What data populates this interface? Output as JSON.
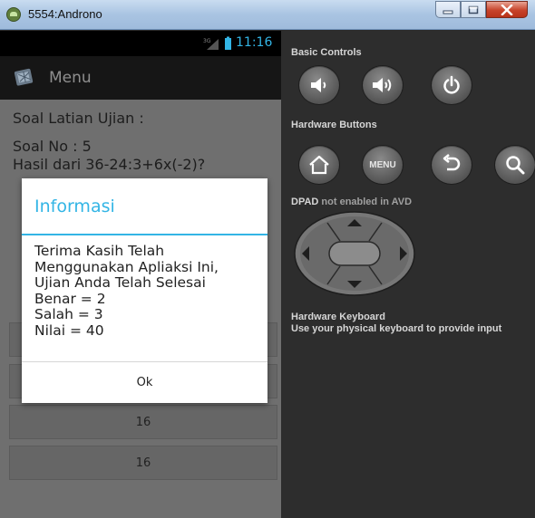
{
  "window": {
    "title": "5554:Androno"
  },
  "phone": {
    "status_time": "11:16",
    "action_bar": {
      "title": "Menu"
    },
    "heading": "Soal Latian Ujian :",
    "question_number": "Soal No : 5",
    "question_text": "Hasil dari 36-24:3+6x(-2)?",
    "answer_buttons": [
      "",
      "",
      "16",
      "16"
    ]
  },
  "dialog": {
    "title": "Informasi",
    "message_lines": [
      "Terima Kasih Telah",
      "Menggunakan Apliaksi Ini,",
      "Ujian Anda Telah Selesai",
      "Benar = 2",
      "Salah = 3",
      "Nilai = 40"
    ],
    "ok_label": "Ok"
  },
  "controls": {
    "basic_label": "Basic Controls",
    "hardware_label": "Hardware Buttons",
    "menu_button_label": "MENU",
    "dpad_prefix": "DPAD",
    "dpad_note": " not enabled in AVD",
    "keyboard_title": "Hardware Keyboard",
    "keyboard_note": "Use your physical keyboard to provide input"
  },
  "colors": {
    "accent": "#33b5e5",
    "phone_background": "#6f6f6f",
    "panel_background": "#2d2d2d"
  },
  "icons": [
    "android-icon",
    "minimize-icon",
    "maximize-icon",
    "close-icon",
    "signal-icon",
    "battery-icon",
    "menu-app-icon",
    "volume-down-icon",
    "volume-up-icon",
    "power-icon",
    "home-icon",
    "back-icon",
    "search-icon",
    "dpad-icon"
  ]
}
